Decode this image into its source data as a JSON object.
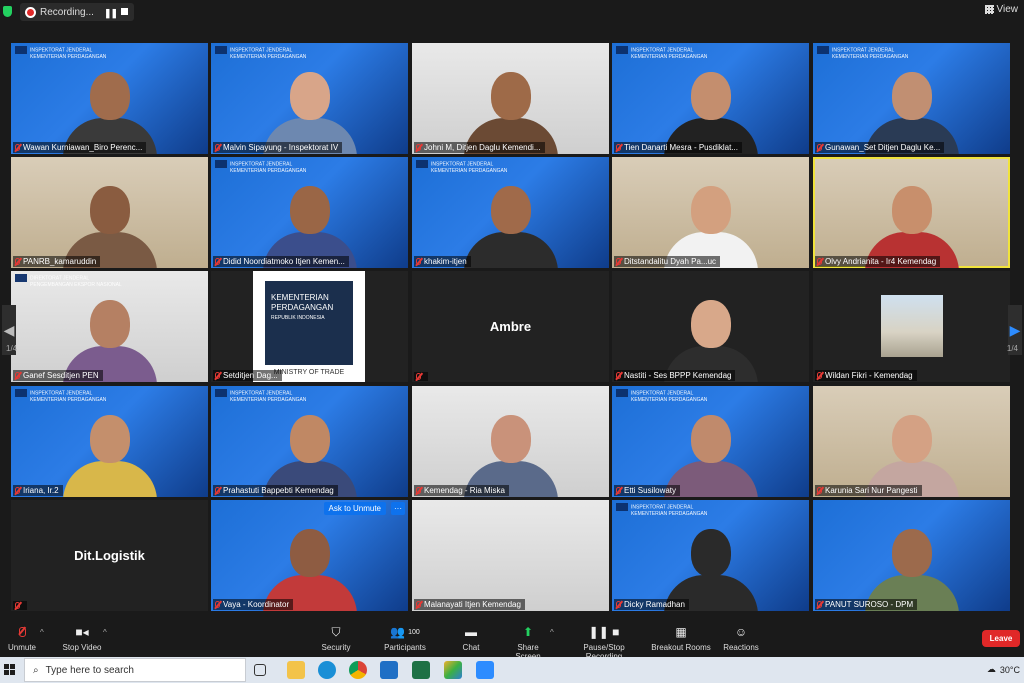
{
  "recording": {
    "label": "Recording..."
  },
  "view_button": {
    "label": "View"
  },
  "tiles": [
    {
      "name": "Wawan Kurniawan_Biro Perenc...",
      "bg": "blue",
      "banner_line1": "INSPEKTORAT JENDERAL",
      "banner_line2": "KEMENTERIAN PERDAGANGAN",
      "skin": "#a06c4c",
      "shirt": "#3a3a3a"
    },
    {
      "name": "Malvin Sipayung - Inspektorat IV",
      "bg": "blue",
      "banner_line1": "INSPEKTORAT JENDERAL",
      "banner_line2": "KEMENTERIAN PERDAGANGAN",
      "skin": "#d8a589",
      "shirt": "#6d88b0"
    },
    {
      "name": "Johni M, Ditjen Daglu Kemendi...",
      "bg": "light",
      "banner_line1": "",
      "banner_line2": "",
      "skin": "#9e6a48",
      "shirt": "#6b4a34"
    },
    {
      "name": "Tien Danarti Mesra - Pusdiklat...",
      "bg": "blue",
      "banner_line1": "INSPEKTORAT JENDERAL",
      "banner_line2": "KEMENTERIAN PERDAGANGAN",
      "skin": "#c48e6e",
      "shirt": "#222"
    },
    {
      "name": "Gunawan_Set Ditjen Daglu Ke...",
      "bg": "blue",
      "banner_line1": "INSPEKTORAT JENDERAL",
      "banner_line2": "KEMENTERIAN PERDAGANGAN",
      "skin": "#c18f72",
      "shirt": "#2a3b55"
    },
    {
      "name": "PANRB_kamaruddin",
      "bg": "room",
      "banner_line1": "",
      "banner_line2": "",
      "skin": "#8a5c40",
      "shirt": "#7a5a44"
    },
    {
      "name": "Didid Noordiatmoko Itjen Kemen...",
      "bg": "blue",
      "banner_line1": "INSPEKTORAT JENDERAL",
      "banner_line2": "KEMENTERIAN PERDAGANGAN",
      "skin": "#9a6646",
      "shirt": "#3b4e8c"
    },
    {
      "name": "khakim-itjen",
      "bg": "blue",
      "banner_line1": "INSPEKTORAT JENDERAL",
      "banner_line2": "KEMENTERIAN PERDAGANGAN",
      "skin": "#a06a4a",
      "shirt": "#2c2c2c"
    },
    {
      "name": "Ditstandalitu Dyah Pa...uc",
      "bg": "room",
      "banner_line1": "",
      "banner_line2": "",
      "skin": "#d3a07f",
      "shirt": "#f2f2f2"
    },
    {
      "name": "Olvy Andrianita - Ir4 Kemendag",
      "bg": "room",
      "banner_line1": "",
      "banner_line2": "",
      "skin": "#c88f6c",
      "shirt": "#b83232"
    },
    {
      "name": "Ganef Sesditjen PEN",
      "bg": "light",
      "banner_line1": "DIREKTORAT JENDERAL",
      "banner_line2": "PENGEMBANGAN EKSPOR NASIONAL",
      "skin": "#b58063",
      "shirt": "#7b5c8e"
    },
    {
      "name": "Setditjen Dag...",
      "bg": "dark",
      "banner_line1": "",
      "banner_line2": "",
      "skin": "",
      "shirt": ""
    },
    {
      "name": "",
      "bg": "dark",
      "banner_line1": "",
      "banner_line2": "",
      "skin": "",
      "shirt": ""
    },
    {
      "name": "Nastiti - Ses BPPP Kemendag",
      "bg": "dark",
      "banner_line1": "",
      "banner_line2": "",
      "skin": "#d8a88a",
      "shirt": "#2d2d2d"
    },
    {
      "name": "Wildan Fikri - Kemendag",
      "bg": "dark",
      "banner_line1": "",
      "banner_line2": "",
      "skin": "",
      "shirt": ""
    },
    {
      "name": "Iriana, Ir.2",
      "bg": "blue",
      "banner_line1": "INSPEKTORAT JENDERAL",
      "banner_line2": "KEMENTERIAN PERDAGANGAN",
      "skin": "#c48f6c",
      "shirt": "#d8b74a"
    },
    {
      "name": "Prahastuti Bappebti Kemendag",
      "bg": "blue",
      "banner_line1": "INSPEKTORAT JENDERAL",
      "banner_line2": "KEMENTERIAN PERDAGANGAN",
      "skin": "#c08864",
      "shirt": "#3a4a7a"
    },
    {
      "name": "Kemendag - Ria Miska",
      "bg": "light",
      "banner_line1": "",
      "banner_line2": "",
      "skin": "#c9927a",
      "shirt": "#5a6a8a"
    },
    {
      "name": "Etti Susilowaty",
      "bg": "blue",
      "banner_line1": "INSPEKTORAT JENDERAL",
      "banner_line2": "KEMENTERIAN PERDAGANGAN",
      "skin": "#c08a6c",
      "shirt": "#7c5b7a"
    },
    {
      "name": "Karunia Sari Nur Pangesti",
      "bg": "room",
      "banner_line1": "",
      "banner_line2": "",
      "skin": "#d4a184",
      "shirt": "#c4a6a0"
    },
    {
      "name": "",
      "bg": "dark",
      "banner_line1": "",
      "banner_line2": "",
      "skin": "",
      "shirt": ""
    },
    {
      "name": "Vaya - Koordinator",
      "bg": "blue",
      "banner_line1": "",
      "banner_line2": "",
      "skin": "#8e5c42",
      "shirt": "#c23a3a"
    },
    {
      "name": "Malanayati Itjen Kemendag",
      "bg": "light",
      "banner_line1": "",
      "banner_line2": "",
      "skin": "",
      "shirt": ""
    },
    {
      "name": "Dicky Ramadhan",
      "bg": "blue",
      "banner_line1": "INSPEKTORAT JENDERAL",
      "banner_line2": "KEMENTERIAN PERDAGANGAN",
      "skin": "#2a2a2a",
      "shirt": "#2a2a2a"
    },
    {
      "name": "PANUT SUROSO - DPM",
      "bg": "blue",
      "banner_line1": "",
      "banner_line2": "",
      "skin": "#9c6a4c",
      "shirt": "#6a7f55"
    }
  ],
  "big_names": {
    "ambre": "Ambre",
    "dit_logistik": "Dit.Logistik"
  },
  "kemendag_logo": {
    "line1": "KEMENTERIAN",
    "line2": "PERDAGANGAN",
    "line3": "REPUBLIK INDONESIA",
    "line4": "MINISTRY OF TRADE"
  },
  "ask_unmute": {
    "label": "Ask to Unmute",
    "more": "···"
  },
  "page_counter": {
    "left": "1/4",
    "right": "1/4"
  },
  "toolbar": {
    "unmute": "Unmute",
    "stop_video": "Stop Video",
    "security": "Security",
    "participants": "Participants",
    "participants_count": "100",
    "chat": "Chat",
    "share_screen": "Share Screen",
    "pause_recording": "Pause/Stop Recording",
    "breakout_rooms": "Breakout Rooms",
    "reactions": "Reactions",
    "leave": "Leave"
  },
  "taskbar": {
    "search_placeholder": "Type here to search",
    "weather": "30°C"
  },
  "colors": {
    "accent_blue": "#0e72ed",
    "leave_red": "#e02828",
    "active_speaker": "#f0e33c",
    "share_green": "#23d160"
  }
}
